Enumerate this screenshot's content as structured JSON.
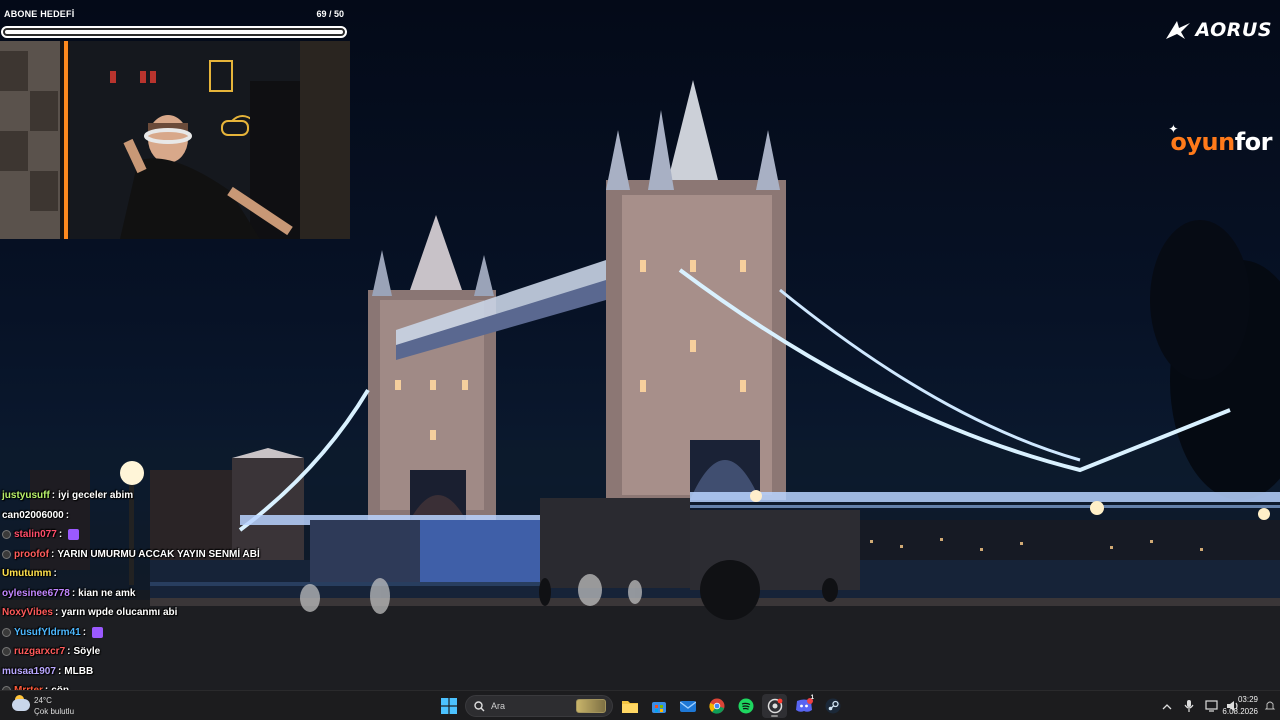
{
  "subscriber_goal": {
    "label": "ABONE HEDEFİ",
    "current": 69,
    "target": 50,
    "count_text": "69 / 50",
    "progress_fraction": 1.0
  },
  "logos": {
    "sponsor_brand": "AORUS",
    "partner_brand_prefix": "oyun",
    "partner_brand_suffix": "for"
  },
  "chat": {
    "messages": [
      {
        "user": "justyusuff",
        "user_color": "#b7f06a",
        "text": "iyi geceler abim",
        "has_badge": false,
        "emote": false
      },
      {
        "user": "can02006000",
        "user_color": "#ffffff",
        "text": "",
        "has_badge": false,
        "emote": false
      },
      {
        "user": "stalin077",
        "user_color": "#ff4d6a",
        "text": "",
        "has_badge": true,
        "emote": true
      },
      {
        "user": "proofof",
        "user_color": "#ff5c5c",
        "text": "YARIN UMURMU ACCAK YAYIN SENMİ ABİ",
        "has_badge": true,
        "emote": false
      },
      {
        "user": "Umutumm",
        "user_color": "#ffe14d",
        "text": "",
        "has_badge": false,
        "emote": false
      },
      {
        "user": "oylesinee6778",
        "user_color": "#c186ff",
        "text": "kian ne amk",
        "has_badge": false,
        "emote": false
      },
      {
        "user": "NoxyVibes",
        "user_color": "#ff5a5a",
        "text": "yarın wpde olucanmı abi",
        "has_badge": false,
        "emote": false
      },
      {
        "user": "YusufYldrm41",
        "user_color": "#4db8ff",
        "text": "",
        "has_badge": true,
        "emote": true
      },
      {
        "user": "ruzgarxcr7",
        "user_color": "#ff5a5a",
        "text": "Söyle",
        "has_badge": true,
        "emote": false
      },
      {
        "user": "musaa1907",
        "user_color": "#b9a7ff",
        "text": "MLBB",
        "has_badge": false,
        "emote": false
      },
      {
        "user": "Mrrter",
        "user_color": "#ff5a3a",
        "text": "çöp",
        "has_badge": true,
        "emote": false
      }
    ]
  },
  "taskbar": {
    "weather": {
      "temp": "24°C",
      "desc": "Çok bulutlu"
    },
    "search_placeholder": "Ara",
    "apps": [
      "windows-start",
      "search",
      "file-explorer",
      "microsoft-store",
      "mail",
      "chrome",
      "spotify",
      "capture",
      "discord",
      "steam"
    ],
    "discord_badge": "1",
    "clock": {
      "time": "03:29",
      "date": "6.08.2026"
    }
  },
  "colors": {
    "goal_bar_fill": "#ffffff",
    "goal_bar_track": "#2b2b2b",
    "oyunfor_accent": "#ff7a1a",
    "taskbar_bg": "#1c1c1e"
  }
}
